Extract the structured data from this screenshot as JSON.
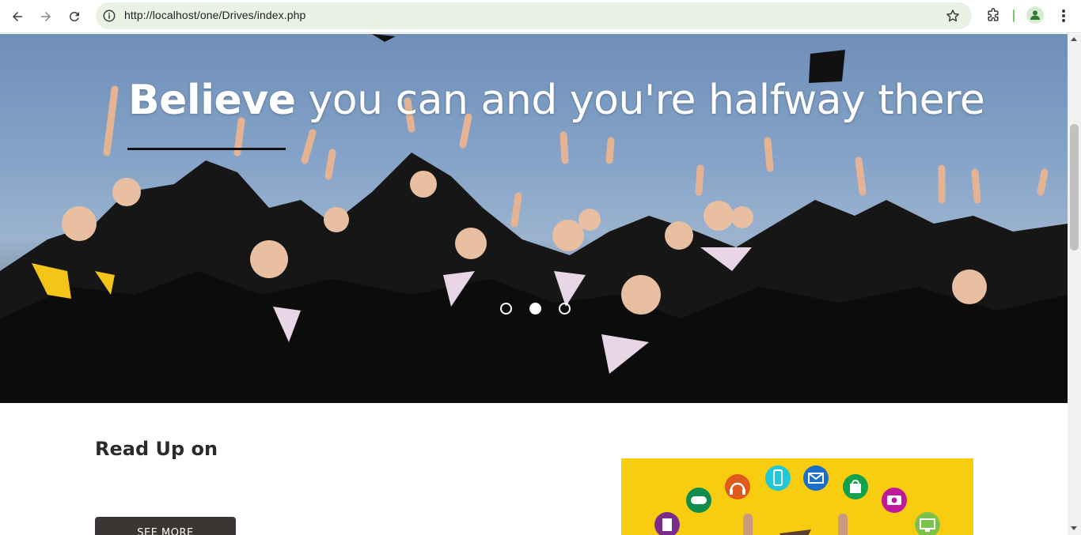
{
  "browser": {
    "url": "http://localhost/one/Drives/index.php",
    "accent_color": "#eaf2e3"
  },
  "hero": {
    "title_bold": "Believe",
    "title_rest": "you can and you're halfway there",
    "slides": 3,
    "active_slide": 2
  },
  "content": {
    "section_title": "Read Up on",
    "see_more_label": "SEE MORE"
  },
  "promo": {
    "background_color": "#f9cd0f",
    "icons": [
      "game-controller-icon",
      "headphones-icon",
      "phone-icon",
      "mail-icon",
      "shopping-bag-icon",
      "camera-icon",
      "document-icon",
      "monitor-icon"
    ]
  }
}
